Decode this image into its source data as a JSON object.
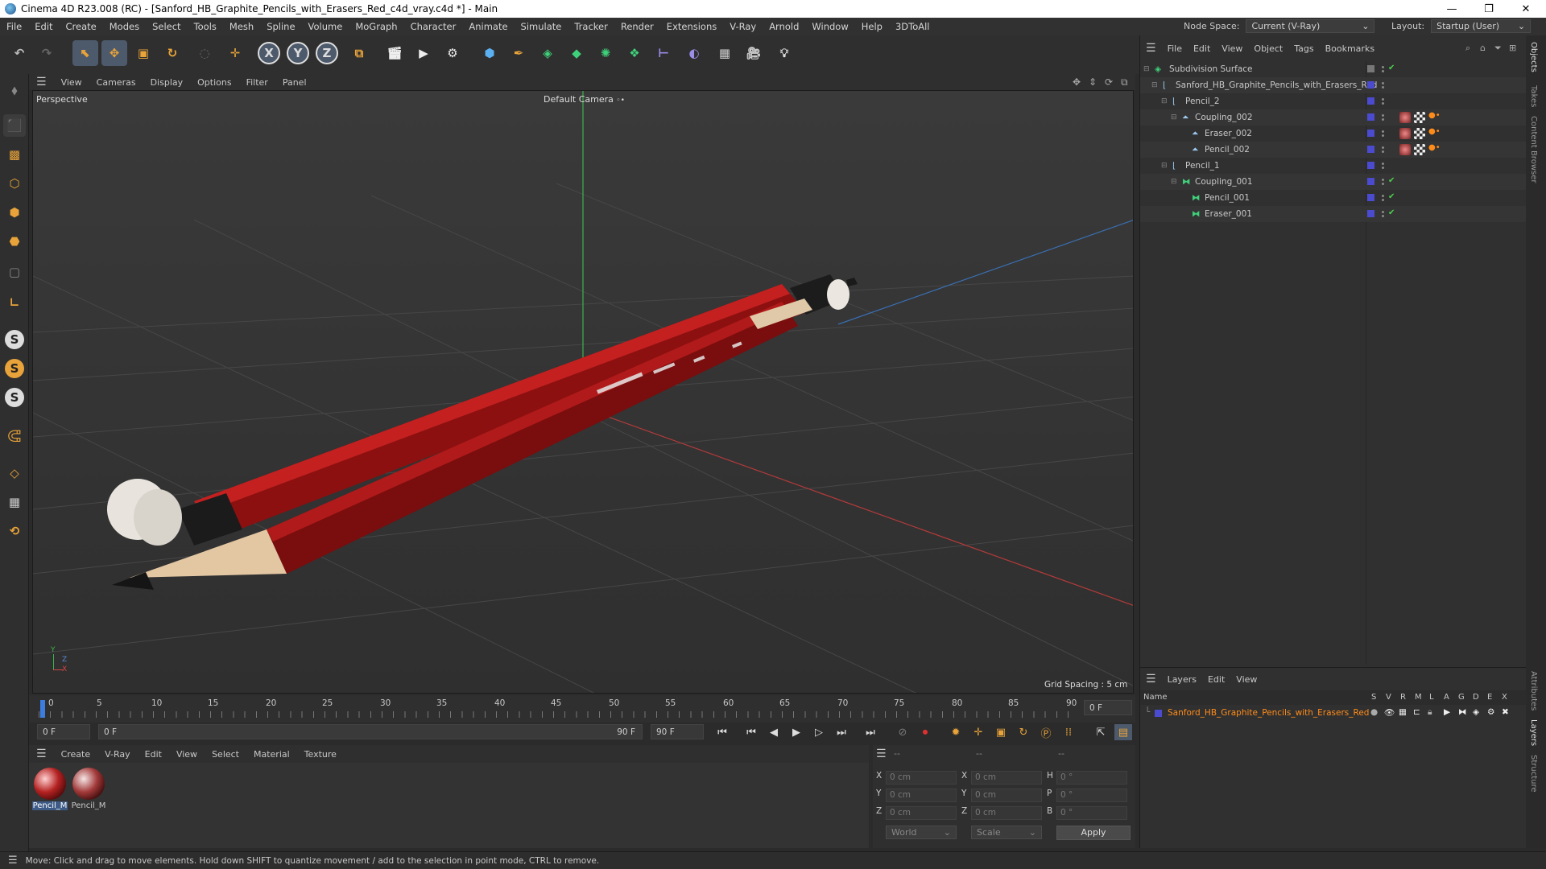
{
  "window": {
    "title": "Cinema 4D R23.008 (RC) - [Sanford_HB_Graphite_Pencils_with_Erasers_Red_c4d_vray.c4d *] - Main",
    "minimize": "—",
    "maximize": "❐",
    "close": "✕"
  },
  "menubar": {
    "items": [
      "File",
      "Edit",
      "Create",
      "Modes",
      "Select",
      "Tools",
      "Mesh",
      "Spline",
      "Volume",
      "MoGraph",
      "Character",
      "Animate",
      "Simulate",
      "Tracker",
      "Render",
      "Extensions",
      "V-Ray",
      "Arnold",
      "Window",
      "Help",
      "3DToAll"
    ],
    "node_space_label": "Node Space:",
    "node_space_value": "Current (V-Ray)",
    "layout_label": "Layout:",
    "layout_value": "Startup (User)"
  },
  "toolbar": {
    "x_label": "X",
    "y_label": "Y",
    "z_label": "Z"
  },
  "left_toolbar": {
    "s_label": "S"
  },
  "viewport": {
    "menu": [
      "View",
      "Cameras",
      "Display",
      "Options",
      "Filter",
      "Panel"
    ],
    "view_name": "Perspective",
    "camera": "Default Camera",
    "camera_icon": "camera-icon",
    "grid_spacing": "Grid Spacing : 5 cm",
    "axis_y": "Y",
    "axis_z": "Z",
    "axis_x": "X"
  },
  "timeline": {
    "ticks": [
      "0",
      "5",
      "10",
      "15",
      "20",
      "25",
      "30",
      "35",
      "40",
      "45",
      "50",
      "55",
      "60",
      "65",
      "70",
      "75",
      "80",
      "85",
      "90"
    ],
    "current_frame": "0 F",
    "start_field": "0 F",
    "range_start": "0 F",
    "range_end": "90 F",
    "end_field": "90 F"
  },
  "material_manager": {
    "menu": [
      "Create",
      "V-Ray",
      "Edit",
      "View",
      "Select",
      "Material",
      "Texture"
    ],
    "materials": [
      {
        "name": "Pencil_M"
      },
      {
        "name": "Pencil_M"
      }
    ]
  },
  "coordinates": {
    "header": [
      "--",
      "--",
      "--"
    ],
    "rows": [
      {
        "a": "X",
        "av": "0 cm",
        "b": "X",
        "bv": "0 cm",
        "c": "H",
        "cv": "0 °"
      },
      {
        "a": "Y",
        "av": "0 cm",
        "b": "Y",
        "bv": "0 cm",
        "c": "P",
        "cv": "0 °"
      },
      {
        "a": "Z",
        "av": "0 cm",
        "b": "Z",
        "bv": "0 cm",
        "c": "B",
        "cv": "0 °"
      }
    ],
    "mode": "World",
    "type": "Scale",
    "apply": "Apply"
  },
  "object_manager": {
    "menu": [
      "File",
      "Edit",
      "View",
      "Object",
      "Tags",
      "Bookmarks"
    ],
    "tree": [
      {
        "name": "Subdivision Surface",
        "level": 0
      },
      {
        "name": "Sanford_HB_Graphite_Pencils_with_Erasers_Red",
        "level": 1
      },
      {
        "name": "Pencil_2",
        "level": 2
      },
      {
        "name": "Coupling_002",
        "level": 3
      },
      {
        "name": "Eraser_002",
        "level": 4
      },
      {
        "name": "Pencil_002",
        "level": 4
      },
      {
        "name": "Pencil_1",
        "level": 2
      },
      {
        "name": "Coupling_001",
        "level": 3
      },
      {
        "name": "Pencil_001",
        "level": 4
      },
      {
        "name": "Eraser_001",
        "level": 4
      }
    ]
  },
  "layers": {
    "menu": [
      "Layers",
      "Edit",
      "View"
    ],
    "name_header": "Name",
    "flags": [
      "S",
      "V",
      "R",
      "M",
      "L",
      "A",
      "G",
      "D",
      "E",
      "X"
    ],
    "layer_name": "Sanford_HB_Graphite_Pencils_with_Erasers_Red"
  },
  "right_tabs": [
    "Objects",
    "Takes",
    "Content Browser",
    "Attributes",
    "Layers",
    "Structure"
  ],
  "status": "Move: Click and drag to move elements. Hold down SHIFT to quantize movement / add to the selection in point mode, CTRL to remove.",
  "colors": {
    "accent": "#4d5a6c",
    "pencil_red": "#9a1212",
    "layer_orange": "#ff8c1a",
    "layer_blue": "#4b4bd0"
  }
}
